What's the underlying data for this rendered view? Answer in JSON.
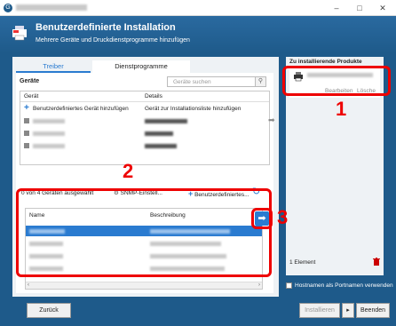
{
  "window": {
    "minimize": "–",
    "maximize": "□",
    "close": "✕"
  },
  "header": {
    "title": "Benutzerdefinierte Installation",
    "subtitle": "Mehrere Geräte und Druckdienstprogramme hinzufügen"
  },
  "tabs": [
    "Treiber",
    "Dienstprogramme"
  ],
  "devices": {
    "section_label": "Geräte",
    "search_placeholder": "Geräte suchen",
    "col_device": "Gerät",
    "col_details": "Details",
    "add_row_label": "Benutzerdefiniertes Gerät hinzufügen",
    "add_row_detail": "Gerät zur Installationsliste hinzufügen"
  },
  "status": {
    "selected_count": "0 von 4 Geräten ausgewählt",
    "snmp_label": "SNMP-Einstell...",
    "custom_label": "Benutzerdefiniertes..."
  },
  "drivers": {
    "col_name": "Name",
    "col_description": "Beschreibung"
  },
  "right_panel": {
    "title": "Zu installierende Produkte",
    "edit": "Bearbeiten",
    "remove": "Lösche",
    "count": "1 Element"
  },
  "host_checkbox_label": "Hostnamen als Portnamen verwenden",
  "footer": {
    "back": "Zurück",
    "install": "Installieren",
    "install_arrow": "▸",
    "finish": "Beenden"
  },
  "callouts": [
    "1",
    "2",
    "3"
  ],
  "colors": {
    "accent": "#2a7bd0",
    "header": "#1e5a8a",
    "callout": "#e00000"
  }
}
